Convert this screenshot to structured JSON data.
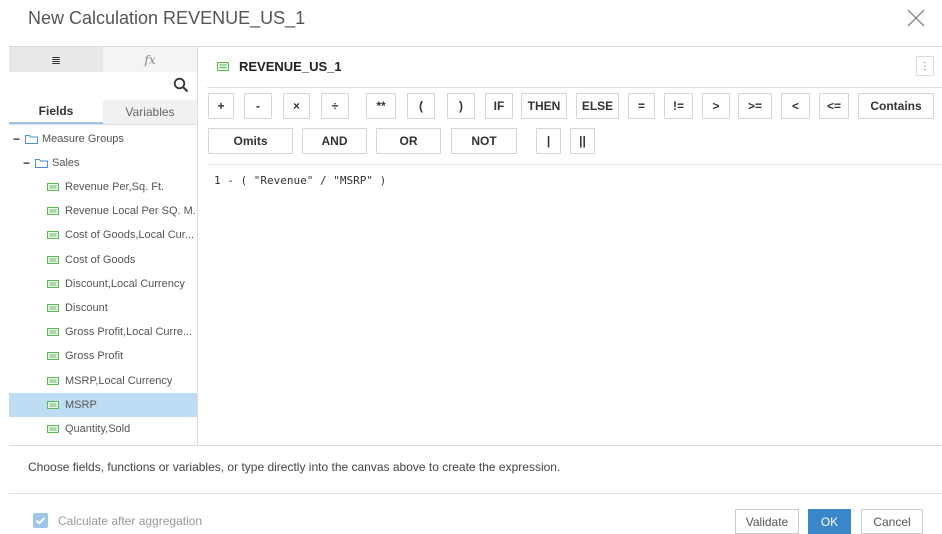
{
  "dialog": {
    "title": "New Calculation REVENUE_US_1"
  },
  "left_panel": {
    "mode_tabs": [
      "≣",
      "fx"
    ],
    "sub_tabs": [
      "Fields",
      "Variables"
    ],
    "tree": {
      "root": "Measure Groups",
      "group": "Sales",
      "items": [
        "Revenue Per,Sq. Ft.",
        "Revenue Local Per SQ. M.",
        "Cost of Goods,Local Cur...",
        "Cost of Goods",
        "Discount,Local Currency",
        "Discount",
        "Gross Profit,Local Curre...",
        "Gross Profit",
        "MSRP,Local Currency",
        "MSRP",
        "Quantity,Sold"
      ],
      "selected": "MSRP"
    }
  },
  "formula": {
    "name": "REVENUE_US_1",
    "menu": "⋮",
    "operators_row1": [
      "+",
      "-",
      "×",
      "÷",
      "**",
      "(",
      ")",
      "IF",
      "THEN",
      "ELSE",
      "=",
      "!=",
      ">",
      ">=",
      "<",
      "<=",
      "Contains"
    ],
    "operators_row2": [
      "Omits",
      "AND",
      "OR",
      "NOT",
      "|",
      "||"
    ],
    "expression": "1 - ( \"Revenue\" / \"MSRP\" )"
  },
  "hint": "Choose fields, functions or variables, or type directly into the canvas above to create the expression.",
  "footer": {
    "checkbox_label": "Calculate after aggregation",
    "checkbox_checked": true,
    "validate": "Validate",
    "ok": "OK",
    "cancel": "Cancel"
  },
  "colors": {
    "accent": "#3b86c8",
    "selection": "#bfdcf5",
    "field_icon": "#5cb85c"
  }
}
